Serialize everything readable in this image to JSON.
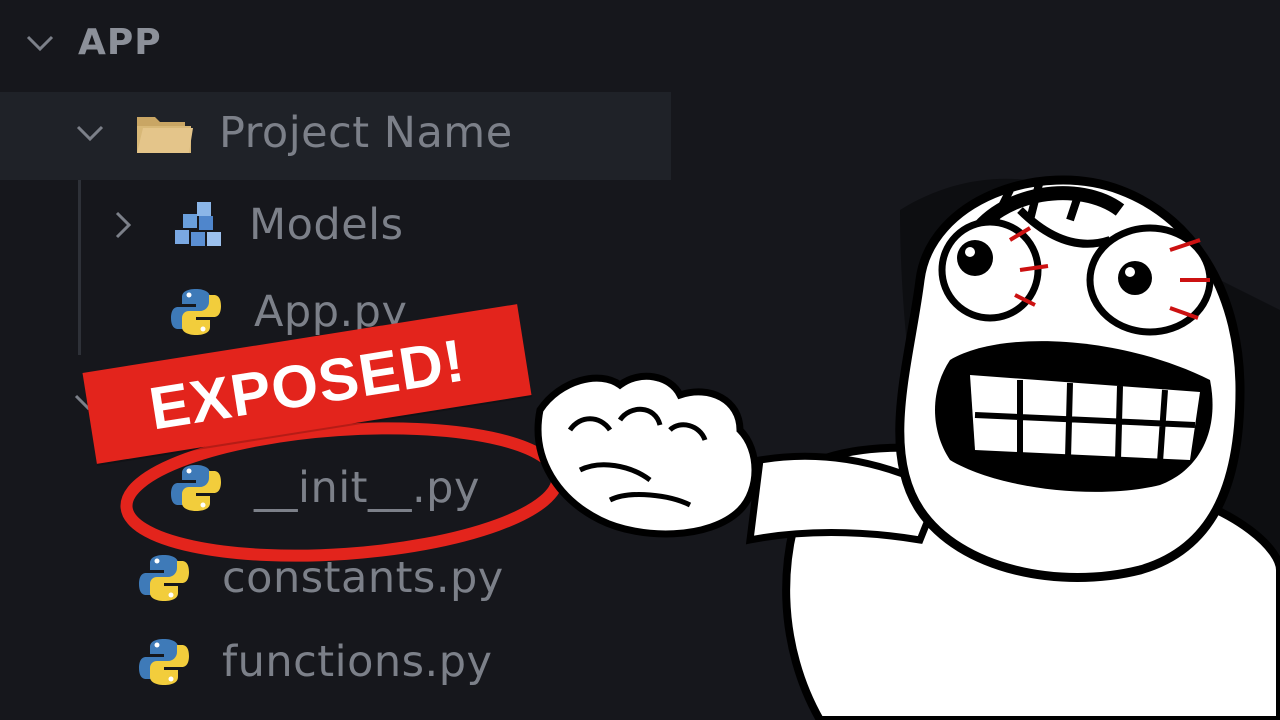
{
  "explorer": {
    "section_title": "APP",
    "project_folder": "Project Name",
    "items": {
      "models": "Models",
      "app_py": "App.py",
      "init_py": "__init__.py",
      "constants_py": "constants.py",
      "functions_py": "functions.py"
    }
  },
  "overlay": {
    "banner_text": "EXPOSED!"
  },
  "colors": {
    "background": "#16171c",
    "highlight": "#1f2228",
    "banner": "#e3241c",
    "ring": "#e3241c",
    "folder": "#d8b877"
  }
}
